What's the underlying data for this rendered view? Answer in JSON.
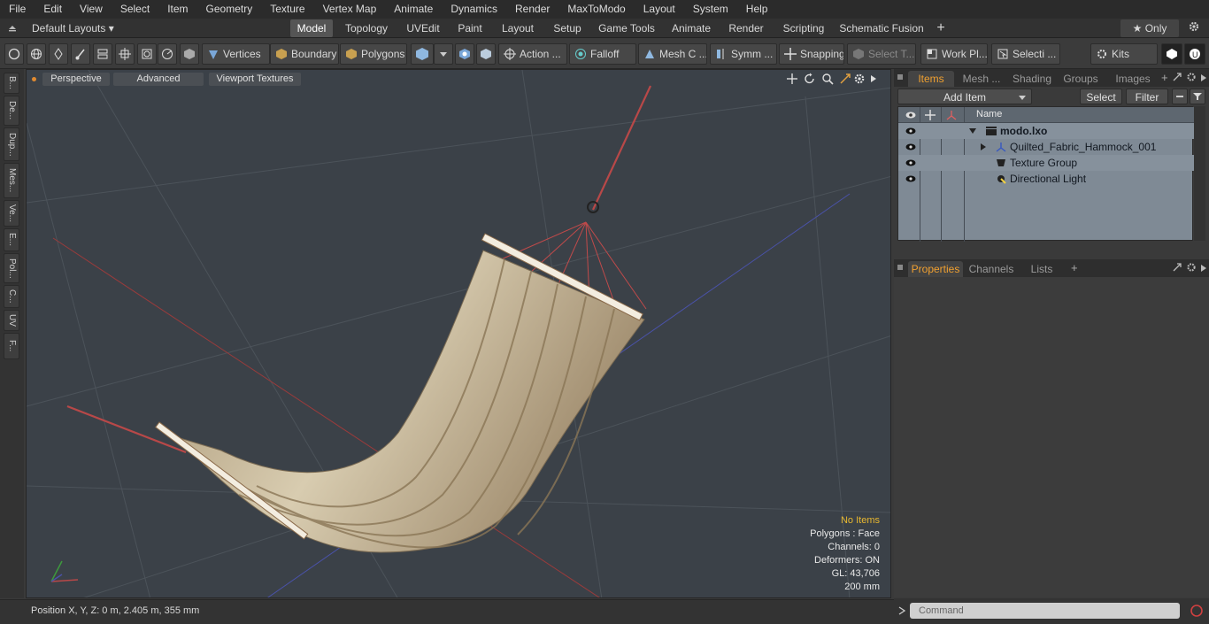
{
  "menu": [
    "File",
    "Edit",
    "View",
    "Select",
    "Item",
    "Geometry",
    "Texture",
    "Vertex Map",
    "Animate",
    "Dynamics",
    "Render",
    "MaxToModo",
    "Layout",
    "System",
    "Help"
  ],
  "layout_bar": {
    "layouts_label": "Default Layouts ▾",
    "tabs": [
      "Model",
      "Topology",
      "UVEdit",
      "Paint",
      "Layout",
      "Setup",
      "Game Tools",
      "Animate",
      "Render",
      "Scripting",
      "Schematic Fusion"
    ],
    "active_tab": "Model",
    "only_label": "★ Only"
  },
  "toolbar": {
    "vertices": "Vertices",
    "boundary": "Boundary",
    "polygons": "Polygons",
    "action": "Action ...",
    "falloff": "Falloff",
    "mesh_c": "Mesh C ...",
    "symm": "Symm ...",
    "snapping": "Snapping",
    "select_t": "Select T...",
    "work_pl": "Work Pl...",
    "selecti": "Selecti ...",
    "kits": "Kits"
  },
  "left_tabs": [
    "B...",
    "De...",
    "Dup...",
    "Mes...",
    "Ve...",
    "E...",
    "Pol...",
    "C...",
    "UV",
    "F..."
  ],
  "viewport": {
    "perspective": "Perspective",
    "advanced": "Advanced",
    "textures": "Viewport Textures",
    "stats": {
      "no_items": "No Items",
      "polygons": "Polygons : Face",
      "channels": "Channels: 0",
      "deformers": "Deformers: ON",
      "gl": "GL: 43,706",
      "scale": "200 mm"
    }
  },
  "status": {
    "position": "Position X, Y, Z:   0 m, 2.405 m, 355 mm"
  },
  "items_panel": {
    "tabs": [
      "Items",
      "Mesh ...",
      "Shading",
      "Groups",
      "Images"
    ],
    "add_item": "Add Item",
    "select": "Select",
    "filter": "Filter",
    "name_header": "Name",
    "tree": [
      {
        "label": "modo.lxo",
        "depth": 0
      },
      {
        "label": "Quilted_Fabric_Hammock_001",
        "depth": 1
      },
      {
        "label": "Texture Group",
        "depth": 1
      },
      {
        "label": "Directional Light",
        "depth": 1
      }
    ]
  },
  "properties_panel": {
    "tabs": [
      "Properties",
      "Channels",
      "Lists"
    ]
  },
  "command": {
    "placeholder": "Command"
  },
  "colors": {
    "accent": "#f0a030",
    "viewport_bg": "#3b4148",
    "stats_warn": "#e8b830"
  }
}
